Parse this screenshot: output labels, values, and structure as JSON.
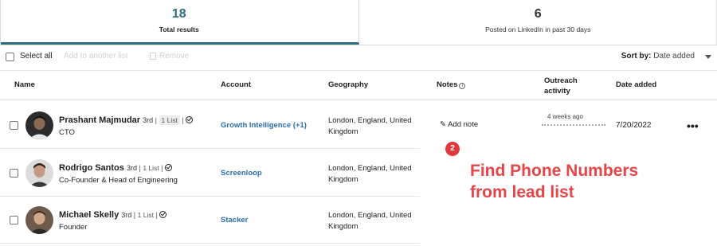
{
  "stats": [
    {
      "number": "18",
      "label": "Total results"
    },
    {
      "number": "6",
      "label": "Posted on LinkedIn in past 30 days"
    }
  ],
  "toolbar": {
    "select_all": "Select all",
    "add_to_list": "Add to another list",
    "remove": "Remove",
    "sort_label": "Sort by:",
    "sort_value": "Date added"
  },
  "columns": {
    "name": "Name",
    "account": "Account",
    "geography": "Geography",
    "notes": "Notes",
    "outreach_line1": "Outreach",
    "outreach_line2": "activity",
    "date_added": "Date added"
  },
  "rows": [
    {
      "name": "Prashant Majmudar",
      "degree": "3rd",
      "list": "1 List",
      "title": "CTO",
      "account": "Growth Intelligence (+1)",
      "geo_line1": "London, England, United",
      "geo_line2": "Kingdom",
      "note": "Add note",
      "outreach_time": "4 weeks ago",
      "date_added": "7/20/2022",
      "more": "•••"
    },
    {
      "name": "Rodrigo Santos",
      "degree": "3rd",
      "list": "1 List",
      "title": "Co-Founder & Head of Engineering",
      "account": "Screenloop",
      "geo_line1": "London, England, United",
      "geo_line2": "Kingdom"
    },
    {
      "name": "Michael Skelly",
      "degree": "3rd",
      "list": "1 List",
      "title": "Founder",
      "account": "Stacker",
      "geo_line1": "London, England, United",
      "geo_line2": "Kingdom"
    }
  ],
  "annotation": {
    "badge": "2",
    "line1": "Find Phone Numbers",
    "line2": "from lead list",
    "color": "#e64548"
  },
  "colors": {
    "accent": "#2e6a80",
    "link": "#2b6fb0",
    "badge": "#e03a3e"
  }
}
